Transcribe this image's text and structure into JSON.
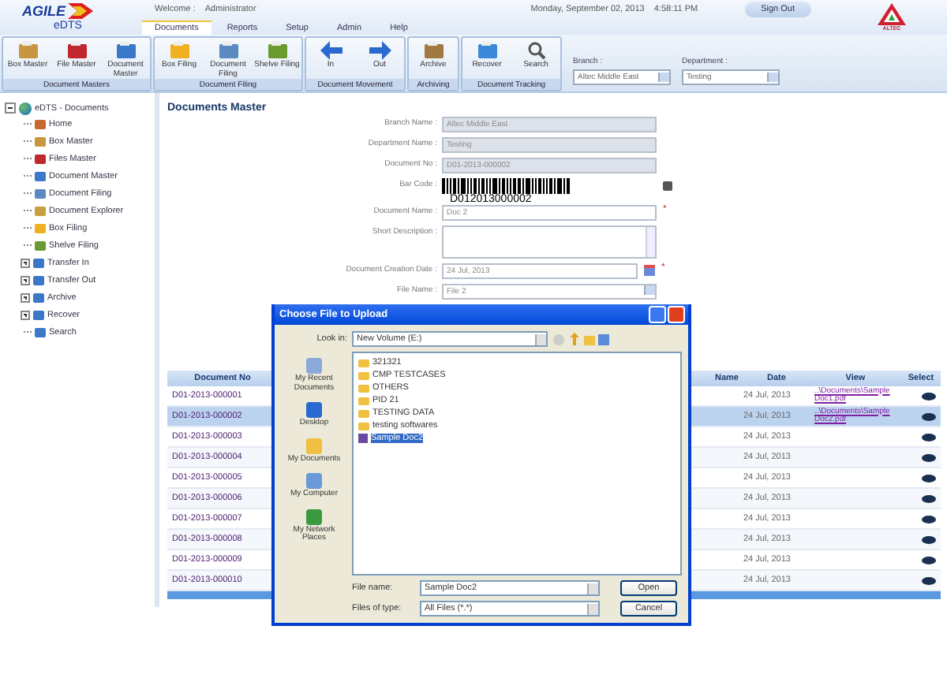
{
  "header": {
    "logo": "AGILE",
    "logo_sub": "eDTS",
    "welcome_label": "Welcome :",
    "user": "Administrator",
    "date": "Monday, September 02, 2013",
    "time": "4:58:11 PM",
    "sign_out": "Sign Out",
    "brand_mark": "ALTEC"
  },
  "tabs": [
    {
      "label": "Documents",
      "selected": true
    },
    {
      "label": "Reports",
      "selected": false
    },
    {
      "label": "Setup",
      "selected": false
    },
    {
      "label": "Admin",
      "selected": false
    },
    {
      "label": "Help",
      "selected": false
    }
  ],
  "toolbar_groups": [
    {
      "title": "Document Masters",
      "buttons": [
        {
          "label": "Box Master",
          "kind": "box"
        },
        {
          "label": "File Master",
          "kind": "file"
        },
        {
          "label": "Document Master",
          "kind": "doc"
        }
      ]
    },
    {
      "title": "Document Filing",
      "buttons": [
        {
          "label": "Box Filing",
          "kind": "boxfiling"
        },
        {
          "label": "Document Filing",
          "kind": "docfiling"
        },
        {
          "label": "Shelve Filing",
          "kind": "shelve"
        }
      ]
    },
    {
      "title": "Document Movement",
      "buttons": [
        {
          "label": "In",
          "kind": "in"
        },
        {
          "label": "Out",
          "kind": "out"
        }
      ]
    },
    {
      "title": "Archiving",
      "buttons": [
        {
          "label": "Archive",
          "kind": "archive"
        }
      ]
    },
    {
      "title": "Document Tracking",
      "buttons": [
        {
          "label": "Recover",
          "kind": "recover"
        },
        {
          "label": "Search",
          "kind": "search"
        }
      ]
    }
  ],
  "filters": [
    {
      "label": "Branch :",
      "value": "Altec Middle East"
    },
    {
      "label": "Department :",
      "value": "Testing"
    }
  ],
  "tree": {
    "label": "eDTS - Documents",
    "expanded": true,
    "children": [
      {
        "label": "Home",
        "kind": "leaf"
      },
      {
        "label": "Box Master",
        "kind": "leaf"
      },
      {
        "label": "Files Master",
        "kind": "leaf"
      },
      {
        "label": "Document Master",
        "kind": "leaf"
      },
      {
        "label": "Document Filing",
        "kind": "leaf"
      },
      {
        "label": "Document Explorer",
        "kind": "leaf"
      },
      {
        "label": "Box Filing",
        "kind": "leaf"
      },
      {
        "label": "Shelve Filing",
        "kind": "leaf"
      },
      {
        "label": "Transfer In",
        "kind": "group",
        "expanded": false
      },
      {
        "label": "Transfer Out",
        "kind": "group",
        "expanded": false
      },
      {
        "label": "Archive",
        "kind": "group",
        "expanded": false
      },
      {
        "label": "Recover",
        "kind": "group",
        "expanded": false
      },
      {
        "label": "Search",
        "kind": "leaf"
      }
    ]
  },
  "page_title": "Documents Master",
  "required_mark": "*",
  "form": [
    {
      "label": "Branch Name :",
      "kind": "readonly",
      "value": "Altec Middle East",
      "required": false
    },
    {
      "label": "Department Name :",
      "kind": "readonly",
      "value": "Testing",
      "required": false
    },
    {
      "label": "Document No :",
      "kind": "readonly",
      "value": "D01-2013-000002",
      "required": false
    },
    {
      "label": "Bar Code :",
      "kind": "barcode",
      "value": "D012013000002",
      "required": false
    },
    {
      "label": "Document Name :",
      "kind": "text",
      "value": "Doc 2",
      "required": true
    },
    {
      "label": "Short Description :",
      "kind": "textarea",
      "required": false
    },
    {
      "label": "Document Creation Date :",
      "kind": "date",
      "value": "24 Jul, 2013",
      "required": true
    },
    {
      "label": "File Name :",
      "kind": "select",
      "value": "File 2",
      "required": false
    }
  ],
  "table": {
    "columns": [
      "Document No",
      "Name",
      "Date",
      "View",
      "Select"
    ],
    "rows": [
      {
        "document_no": "D01-2013-000001",
        "date": "24 Jul, 2013",
        "view": "..\\Documents\\Sample Doc1.pdf",
        "selected": false
      },
      {
        "document_no": "D01-2013-000002",
        "date": "24 Jul, 2013",
        "view": "..\\Documents\\Sample Doc2.pdf",
        "selected": true
      },
      {
        "document_no": "D01-2013-000003",
        "date": "24 Jul, 2013",
        "selected": false
      },
      {
        "document_no": "D01-2013-000004",
        "date": "24 Jul, 2013",
        "selected": false
      },
      {
        "document_no": "D01-2013-000005",
        "date": "24 Jul, 2013",
        "selected": false
      },
      {
        "document_no": "D01-2013-000006",
        "date": "24 Jul, 2013",
        "selected": false
      },
      {
        "document_no": "D01-2013-000007",
        "date": "24 Jul, 2013",
        "selected": false
      },
      {
        "document_no": "D01-2013-000008",
        "date": "24 Jul, 2013",
        "selected": false
      },
      {
        "document_no": "D01-2013-000009",
        "date": "24 Jul, 2013",
        "selected": false
      },
      {
        "document_no": "D01-2013-000010",
        "date": "24 Jul, 2013",
        "selected": false
      }
    ]
  },
  "dialog": {
    "title": "Choose File to Upload",
    "look_in_label": "Look in:",
    "look_in": "New Volume (E:)",
    "places": [
      {
        "label": "My Recent Documents",
        "kind": "recent"
      },
      {
        "label": "Desktop",
        "kind": "desktop"
      },
      {
        "label": "My Documents",
        "kind": "documents"
      },
      {
        "label": "My Computer",
        "kind": "computer"
      },
      {
        "label": "My Network Places",
        "kind": "network"
      }
    ],
    "files": [
      {
        "name": "321321",
        "kind": "folder",
        "selected": false
      },
      {
        "name": "CMP TESTCASES",
        "kind": "folder",
        "selected": false
      },
      {
        "name": "OTHERS",
        "kind": "folder",
        "selected": false
      },
      {
        "name": "PID 21",
        "kind": "folder",
        "selected": false
      },
      {
        "name": "TESTING DATA",
        "kind": "folder",
        "selected": false
      },
      {
        "name": "testing softwares",
        "kind": "folder",
        "selected": false
      },
      {
        "name": "Sample Doc2",
        "kind": "file",
        "selected": true
      }
    ],
    "file_name_label": "File name:",
    "file_name": "Sample Doc2",
    "type_label": "Files of type:",
    "type": "All Files (*.*)",
    "buttons": [
      "Open",
      "Cancel"
    ]
  }
}
